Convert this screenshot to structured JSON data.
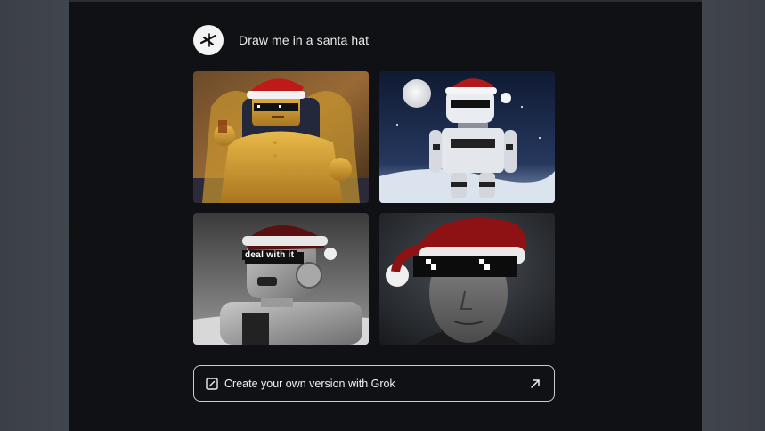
{
  "post": {
    "prompt": "Draw me in a santa hat",
    "avatar_icon": "grok-logo-icon",
    "images": [
      {
        "subject": "golden robot wearing santa hat and pixel sunglasses on throne"
      },
      {
        "subject": "white robot wearing santa hat under full moon in snow"
      },
      {
        "subject": "robot head in santa hat with pixel glasses"
      },
      {
        "subject": "man in santa hat with pixel sunglasses"
      }
    ],
    "overlay_text": "deal with it"
  },
  "cta": {
    "label": "Create your own version with Grok",
    "left_icon": "edit-square-icon",
    "right_icon": "arrow-up-right-icon"
  },
  "colors": {
    "panel_bg": "#0f1114",
    "side_bg": "#3a3e45",
    "text": "#ececec",
    "border": "#c9ccd0"
  }
}
